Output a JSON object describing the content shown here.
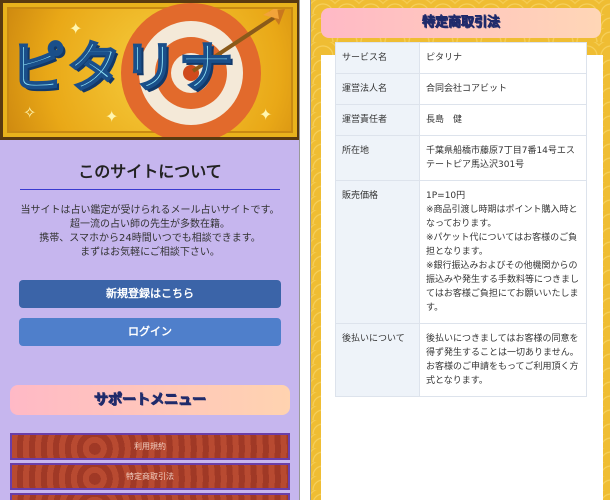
{
  "banner": {
    "logo_text": "ピタリナ"
  },
  "about": {
    "title": "このサイトについて",
    "lines": [
      "当サイトは占い鑑定が受けられるメール占いサイトです。",
      "超一流の占い師の先生が多数在籍。",
      "携帯、スマホから24時間いつでも相談できます。",
      "まずはお気軽にご相談下さい。"
    ],
    "register_label": "新規登録はこちら",
    "login_label": "ログイン"
  },
  "support": {
    "title": "サポートメニュー",
    "items": [
      "利用規約",
      "特定商取引法",
      ""
    ]
  },
  "legal": {
    "title": "特定商取引法",
    "rows": [
      {
        "key": "サービス名",
        "value": "ピタリナ"
      },
      {
        "key": "運営法人名",
        "value": "合同会社コアビット"
      },
      {
        "key": "運営責任者",
        "value": "長島　健"
      },
      {
        "key": "所在地",
        "value": "千葉県船橋市藤原7丁目7番14号エステートピア馬込沢301号"
      }
    ],
    "price": {
      "key": "販売価格",
      "lines": [
        "1P=10円",
        "※商品引渡し時期はポイント購入時となっております。",
        "※パケット代についてはお客様のご負担となります。",
        "※銀行振込みおよびその他機関からの振込みや発生する手数料等につきましてはお客様ご負担にてお願いいたします。"
      ]
    },
    "postpay": {
      "key": "後払いについて",
      "lines": [
        "後払いにつきましてはお客様の同意を得ず発生することは一切ありません。",
        "お客様のご申請をもってご利用頂く方式となります。"
      ]
    }
  }
}
